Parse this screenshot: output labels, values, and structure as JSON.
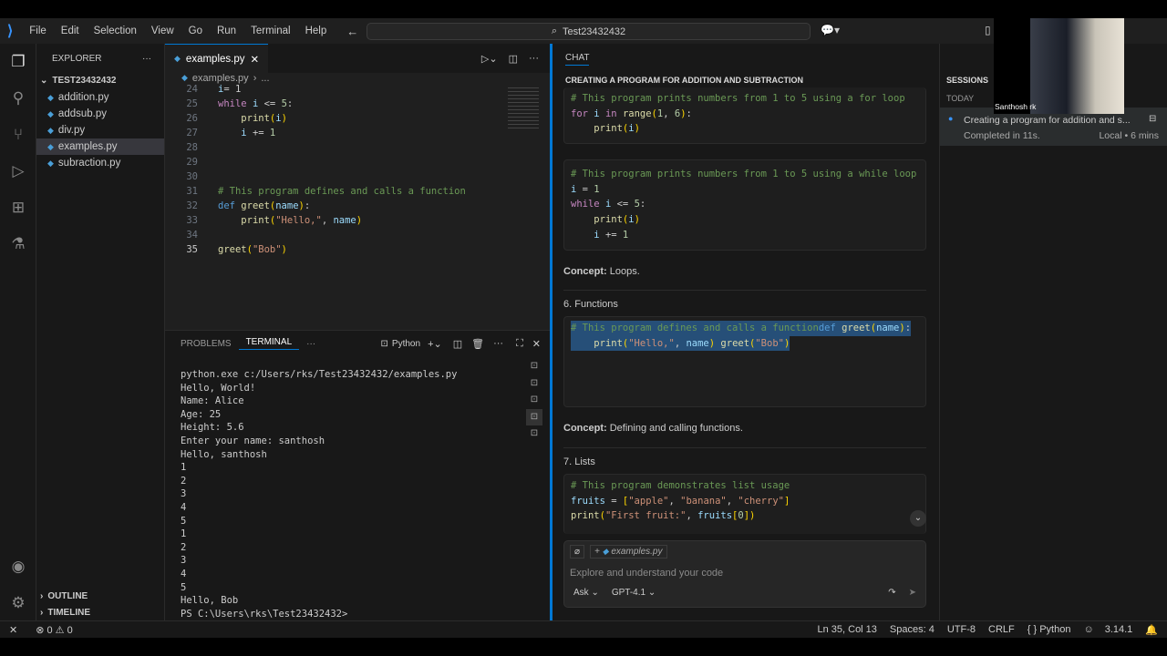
{
  "menu": [
    "File",
    "Edit",
    "Selection",
    "View",
    "Go",
    "Run",
    "Terminal",
    "Help"
  ],
  "search": "Test23432432",
  "explorer": {
    "title": "EXPLORER",
    "folder": "TEST23432432",
    "files": [
      "addition.py",
      "addsub.py",
      "div.py",
      "examples.py",
      "subraction.py"
    ],
    "outline": "OUTLINE",
    "timeline": "TIMELINE"
  },
  "editor": {
    "tab": "examples.py",
    "breadcrumb": "examples.py",
    "breadcrumb_rest": "...",
    "lines": [
      {
        "n": "24",
        "t": [
          [
            "var",
            "i"
          ],
          [
            "",
            "= 1"
          ]
        ]
      },
      {
        "n": "25",
        "t": [
          [
            "kw",
            "while"
          ],
          [
            "",
            " "
          ],
          [
            "var",
            "i"
          ],
          [
            "",
            " <= "
          ],
          [
            "nm",
            "5"
          ],
          [
            "",
            ":"
          ]
        ]
      },
      {
        "n": "26",
        "t": [
          [
            "",
            "    "
          ],
          [
            "fn",
            "print"
          ],
          [
            "br",
            "("
          ],
          [
            "var",
            "i"
          ],
          [
            "br",
            ")"
          ]
        ]
      },
      {
        "n": "27",
        "t": [
          [
            "",
            "    "
          ],
          [
            "var",
            "i"
          ],
          [
            "",
            " += "
          ],
          [
            "nm",
            "1"
          ]
        ]
      },
      {
        "n": "28",
        "t": []
      },
      {
        "n": "29",
        "t": []
      },
      {
        "n": "30",
        "t": []
      },
      {
        "n": "31",
        "t": [
          [
            "cm",
            "# This program defines and calls a function"
          ]
        ]
      },
      {
        "n": "32",
        "t": [
          [
            "df",
            "def"
          ],
          [
            "",
            " "
          ],
          [
            "fn",
            "greet"
          ],
          [
            "br",
            "("
          ],
          [
            "var",
            "name"
          ],
          [
            "br",
            ")"
          ],
          [
            "",
            ":"
          ]
        ]
      },
      {
        "n": "33",
        "t": [
          [
            "",
            "    "
          ],
          [
            "fn",
            "print"
          ],
          [
            "br",
            "("
          ],
          [
            "st",
            "\"Hello,\""
          ],
          [
            "",
            ", "
          ],
          [
            "var",
            "name"
          ],
          [
            "br",
            ")"
          ]
        ]
      },
      {
        "n": "34",
        "t": []
      },
      {
        "n": "35",
        "t": [
          [
            "fn",
            "greet"
          ],
          [
            "br",
            "("
          ],
          [
            "st",
            "\"Bob\""
          ],
          [
            "br",
            ")"
          ]
        ]
      }
    ]
  },
  "panel": {
    "tabs": [
      "PROBLEMS",
      "TERMINAL"
    ],
    "shell": "Python",
    "terminal": [
      "python.exe c:/Users/rks/Test23432432/examples.py",
      "Hello, World!",
      "Name: Alice",
      "Age: 25",
      "Height: 5.6",
      "Enter your name: santhosh",
      "Hello, santhosh",
      "1",
      "2",
      "3",
      "4",
      "5",
      "1",
      "2",
      "3",
      "4",
      "5",
      "Hello, Bob",
      "PS C:\\Users\\rks\\Test23432432> "
    ]
  },
  "chat": {
    "tab": "CHAT",
    "title": "CREATING A PROGRAM FOR ADDITION AND SUBTRACTION",
    "block1": [
      [
        [
          "cm",
          "# This program prints numbers from 1 to 5 using a for loop"
        ]
      ],
      [
        [
          "kw",
          "for"
        ],
        [
          "",
          " "
        ],
        [
          "var",
          "i"
        ],
        [
          "",
          " "
        ],
        [
          "kw",
          "in"
        ],
        [
          "",
          " "
        ],
        [
          "fn",
          "range"
        ],
        [
          "br",
          "("
        ],
        [
          "nm",
          "1"
        ],
        [
          "",
          ", "
        ],
        [
          "nm",
          "6"
        ],
        [
          "br",
          ")"
        ],
        [
          "",
          ":"
        ]
      ],
      [
        [
          "",
          "    "
        ],
        [
          "fn",
          "print"
        ],
        [
          "br",
          "("
        ],
        [
          "var",
          "i"
        ],
        [
          "br",
          ")"
        ]
      ]
    ],
    "block2": [
      [
        [
          "cm",
          "# This program prints numbers from 1 to 5 using a while loop"
        ]
      ],
      [
        [
          "var",
          "i"
        ],
        [
          "",
          " = "
        ],
        [
          "nm",
          "1"
        ]
      ],
      [
        [
          "kw",
          "while"
        ],
        [
          "",
          " "
        ],
        [
          "var",
          "i"
        ],
        [
          "",
          " <= "
        ],
        [
          "nm",
          "5"
        ],
        [
          "",
          ":"
        ]
      ],
      [
        [
          "",
          "    "
        ],
        [
          "fn",
          "print"
        ],
        [
          "br",
          "("
        ],
        [
          "var",
          "i"
        ],
        [
          "br",
          ")"
        ]
      ],
      [
        [
          "",
          "    "
        ],
        [
          "var",
          "i"
        ],
        [
          "",
          " += "
        ],
        [
          "nm",
          "1"
        ]
      ]
    ],
    "concept1_label": "Concept:",
    "concept1": "Loops.",
    "section6": "6. Functions",
    "block3": [
      [
        [
          "cm",
          "# This program defines and calls a function"
        ]
      ],
      [
        [
          "df",
          "def"
        ],
        [
          "",
          " "
        ],
        [
          "fn",
          "greet"
        ],
        [
          "br",
          "("
        ],
        [
          "var",
          "name"
        ],
        [
          "br",
          ")"
        ],
        [
          "",
          ":"
        ]
      ],
      [
        [
          "",
          "    "
        ],
        [
          "fn",
          "print"
        ],
        [
          "br",
          "("
        ],
        [
          "st",
          "\"Hello,\""
        ],
        [
          "",
          ", "
        ],
        [
          "var",
          "name"
        ],
        [
          "br",
          ")"
        ]
      ],
      [],
      [
        [
          "fn",
          "greet"
        ],
        [
          "br",
          "("
        ],
        [
          "st",
          "\"Bob\""
        ],
        [
          "br",
          ")"
        ]
      ]
    ],
    "concept2_label": "Concept:",
    "concept2": "Defining and calling functions.",
    "section7": "7. Lists",
    "block4": [
      [
        [
          "cm",
          "# This program demonstrates list usage"
        ]
      ],
      [
        [
          "var",
          "fruits"
        ],
        [
          "",
          " = "
        ],
        [
          "br",
          "["
        ],
        [
          "st",
          "\"apple\""
        ],
        [
          "",
          ", "
        ],
        [
          "st",
          "\"banana\""
        ],
        [
          "",
          ", "
        ],
        [
          "st",
          "\"cherry\""
        ],
        [
          "br",
          "]"
        ]
      ],
      [
        [
          "fn",
          "print"
        ],
        [
          "br",
          "("
        ],
        [
          "st",
          "\"First fruit:\""
        ],
        [
          "",
          ", "
        ],
        [
          "var",
          "fruits"
        ],
        [
          "br",
          "["
        ],
        [
          "nm",
          "0"
        ],
        [
          "br",
          "]"
        ],
        [
          "br",
          ")"
        ]
      ]
    ],
    "attachment": "examples.py",
    "input_placeholder": "Explore and understand your code",
    "mode": "Ask",
    "model": "GPT-4.1"
  },
  "sessions": {
    "title": "SESSIONS",
    "group": "TODAY",
    "item_title": "Creating a program for addition and s...",
    "item_status": "Completed in 11s.",
    "item_meta": "Local • 6 mins"
  },
  "webcam_name": "Santhosh rk",
  "status": {
    "errors": "0",
    "warnings": "0",
    "position": "Ln 35, Col 13",
    "spaces": "Spaces: 4",
    "encoding": "UTF-8",
    "eol": "CRLF",
    "language": "Python",
    "version": "3.14.1"
  }
}
